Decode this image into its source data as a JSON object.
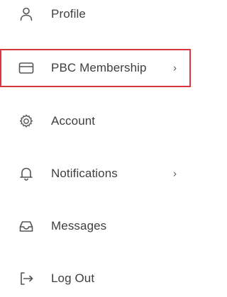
{
  "menu": {
    "accent_color": "#d9363e",
    "items": [
      {
        "label": "Profile",
        "icon": "user-icon",
        "has_chevron": false,
        "selected": false
      },
      {
        "label": "PBC Membership",
        "icon": "card-icon",
        "has_chevron": true,
        "chevron": "›",
        "selected": true
      },
      {
        "label": "Account",
        "icon": "gear-icon",
        "has_chevron": false,
        "selected": false
      },
      {
        "label": "Notifications",
        "icon": "bell-icon",
        "has_chevron": true,
        "chevron": "›",
        "selected": false
      },
      {
        "label": "Messages",
        "icon": "inbox-icon",
        "has_chevron": false,
        "selected": false
      },
      {
        "label": "Log Out",
        "icon": "logout-icon",
        "has_chevron": false,
        "selected": false
      }
    ]
  }
}
